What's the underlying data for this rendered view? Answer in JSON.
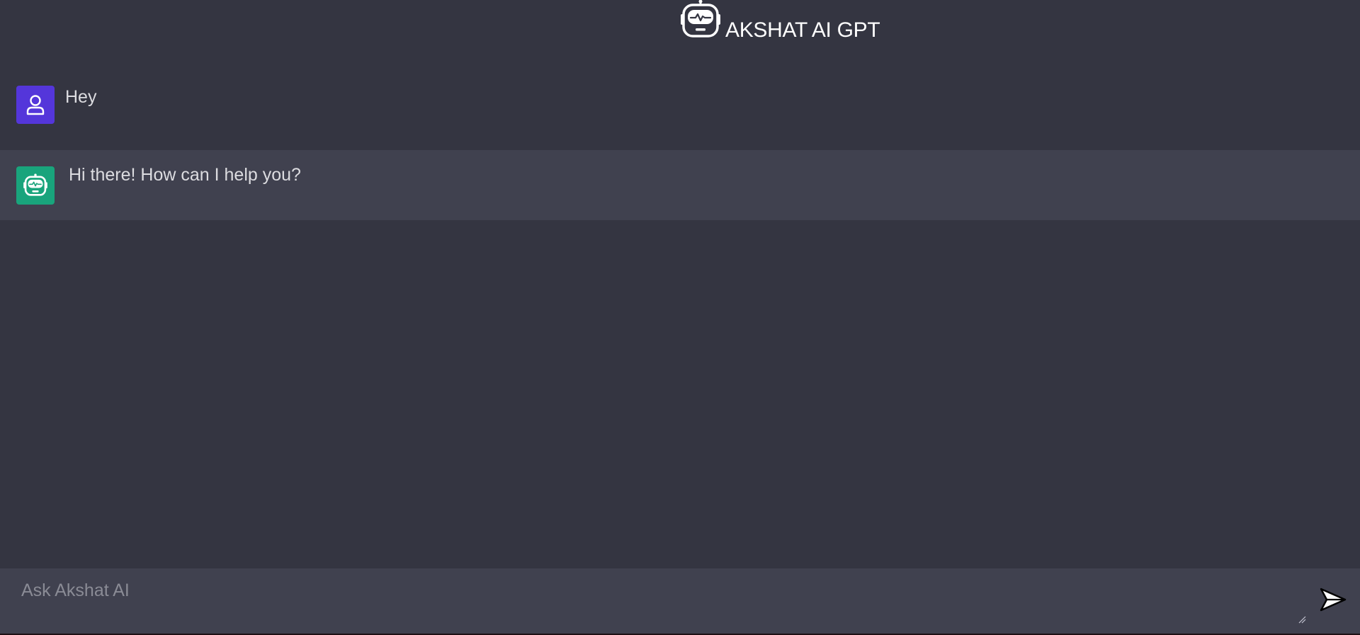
{
  "header": {
    "title": "AKSHAT AI GPT",
    "logo_icon": "robot-icon"
  },
  "conversation": {
    "messages": [
      {
        "role": "user",
        "avatar_icon": "user-icon",
        "avatar_color": "#5436da",
        "text": "Hey"
      },
      {
        "role": "assistant",
        "avatar_icon": "robot-icon",
        "avatar_color": "#19a47c",
        "text": "Hi there! How can I help you?"
      }
    ]
  },
  "composer": {
    "placeholder": "Ask Akshat AI",
    "value": "",
    "send_icon": "send-icon"
  },
  "colors": {
    "background": "#343541",
    "assistant_row": "#40414f",
    "composer": "#40414f",
    "text": "#dcdce0",
    "placeholder": "#8a8b95"
  }
}
